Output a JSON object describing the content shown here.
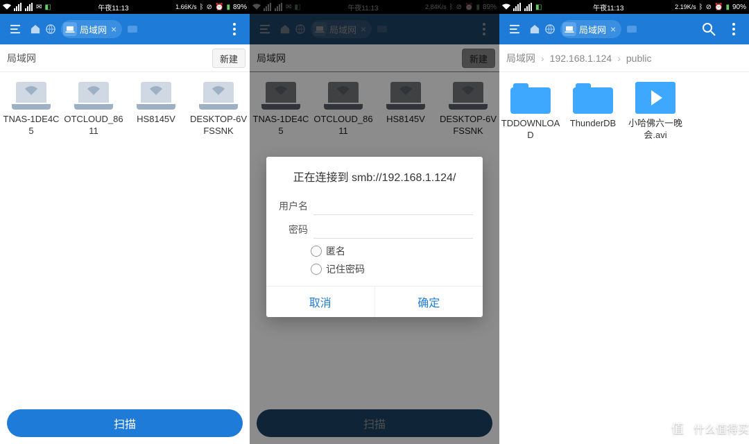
{
  "status": {
    "time": "午夜11:13",
    "battery": "89%",
    "battery3": "90%",
    "speed1": "1.66K/s",
    "speed2": "2.84K/s",
    "speed3": "2.19K/s"
  },
  "toolbar": {
    "tab_label": "局域网"
  },
  "pane1": {
    "breadcrumb": "局域网",
    "new_btn": "新建",
    "devices": [
      {
        "name": "TNAS-1DE4C5"
      },
      {
        "name": "OTCLOUD_8611"
      },
      {
        "name": "HS8145V"
      },
      {
        "name": "DESKTOP-6VFSSNK"
      }
    ],
    "scan": "扫描"
  },
  "pane2": {
    "breadcrumb": "局域网",
    "new_btn": "新建",
    "devices": [
      {
        "name": "TNAS-1DE4C5"
      },
      {
        "name": "OTCLOUD_8611"
      },
      {
        "name": "HS8145V"
      },
      {
        "name": "DESKTOP-6VFSSNK"
      }
    ],
    "scan": "扫描",
    "dialog": {
      "title": "正在连接到 smb://192.168.1.124/",
      "user_label": "用户名",
      "pass_label": "密码",
      "anon": "匿名",
      "remember": "记住密码",
      "cancel": "取消",
      "ok": "确定"
    }
  },
  "pane3": {
    "crumbs": [
      "局域网",
      "192.168.1.124",
      "public"
    ],
    "items": [
      {
        "type": "folder",
        "name": "TDDOWNLOAD"
      },
      {
        "type": "folder",
        "name": "ThunderDB"
      },
      {
        "type": "video",
        "name": "小哈佛六一晚会.avi"
      }
    ]
  },
  "watermark": "什么值得买"
}
